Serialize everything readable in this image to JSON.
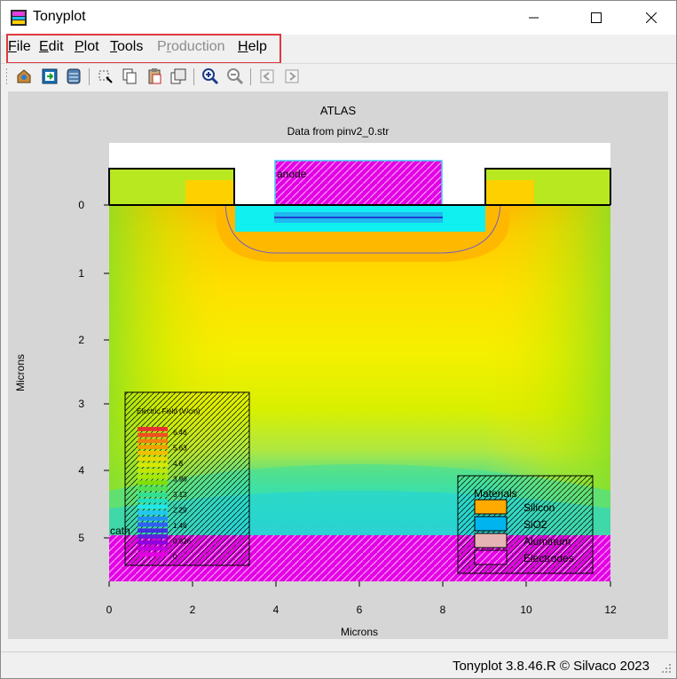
{
  "window": {
    "title": "Tonyplot"
  },
  "menu": {
    "file": {
      "label": "File",
      "accel": "F"
    },
    "edit": {
      "label": "Edit",
      "accel": "E"
    },
    "plot": {
      "label": "Plot",
      "accel": "P"
    },
    "tools": {
      "label": "Tools",
      "accel": "T"
    },
    "production": {
      "label": "Production",
      "accel": "r",
      "enabled": false
    },
    "help": {
      "label": "Help",
      "accel": "H"
    }
  },
  "toolbar": {
    "icons": [
      "open-icon",
      "import-icon",
      "print-icon",
      "select-icon",
      "copy-icon",
      "paste-icon",
      "overlay-icon",
      "zoom-in-icon",
      "zoom-out-icon",
      "previous-icon",
      "next-icon"
    ]
  },
  "plot": {
    "title": "ATLAS",
    "subtitle": "Data from pinv2_0.str",
    "xlabel": "Microns",
    "ylabel": "Microns",
    "electrode_labels": {
      "anode": "anode",
      "cathode": "cath"
    },
    "field_legend": {
      "title": "Electric Field (V/cm)",
      "labels": [
        "6.46",
        "5.63",
        "4.8",
        "3.96",
        "3.13",
        "2.29",
        "1.46",
        "0.626",
        "0"
      ]
    },
    "materials_legend": {
      "title": "Materials",
      "items": [
        {
          "label": "Silicon",
          "color": "#ffaa00"
        },
        {
          "label": "SiO2",
          "color": "#00b4f0"
        },
        {
          "label": "Aluminum",
          "color": "#e6b4b4"
        },
        {
          "label": "Electrodes",
          "color": "#e400e4"
        }
      ]
    }
  },
  "chart_data": {
    "type": "heatmap",
    "title": "ATLAS",
    "subtitle": "Data from pinv2_0.str",
    "xlabel": "Microns",
    "ylabel": "Microns",
    "xlim": [
      0,
      12
    ],
    "ylim": [
      5.7,
      -0.9
    ],
    "xticks": [
      0,
      2,
      4,
      6,
      8,
      10,
      12
    ],
    "yticks": [
      0,
      1,
      2,
      3,
      4,
      5
    ],
    "quantity": "Electric Field (V/cm)",
    "colorbar_ticks": [
      6.46,
      5.63,
      4.8,
      3.96,
      3.13,
      2.29,
      1.46,
      0.626,
      0
    ],
    "materials": [
      "Silicon",
      "SiO2",
      "Aluminum",
      "Electrodes"
    ]
  },
  "status": {
    "text": "Tonyplot 3.8.46.R © Silvaco 2023"
  }
}
